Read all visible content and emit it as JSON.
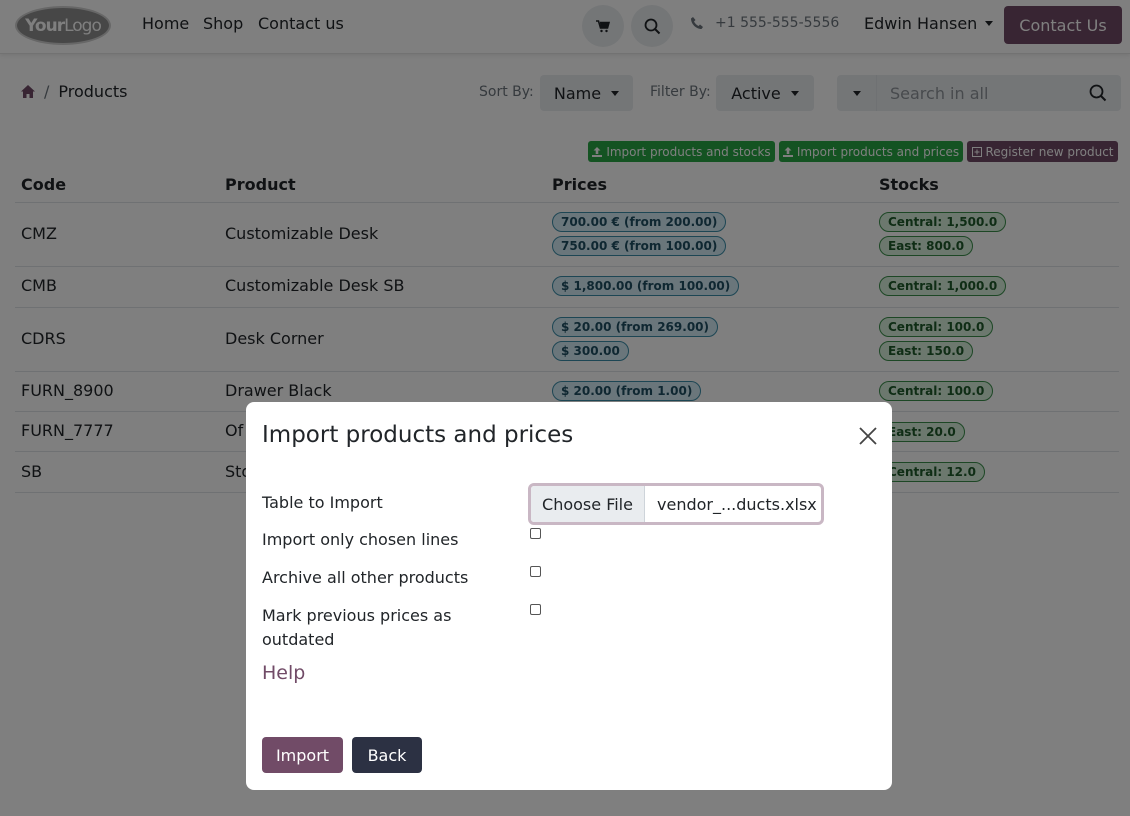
{
  "navbar": {
    "logo_text_bold": "Your",
    "logo_text_thin": "Logo",
    "links": [
      "Home",
      "Shop",
      "Contact us"
    ],
    "cart_icon": "shopping-cart-icon",
    "search_icon": "search-icon",
    "phone": "+1 555-555-5556",
    "user_name": "Edwin Hansen",
    "contact_button": "Contact Us"
  },
  "breadcrumb": {
    "home_icon": "home-icon",
    "separator": "/",
    "current": "Products"
  },
  "toolbar": {
    "sort_label": "Sort By:",
    "sort_value": "Name",
    "filter_label": "Filter By:",
    "filter_value": "Active",
    "search_placeholder": "Search in all"
  },
  "actions": {
    "import_stocks": "Import products and stocks",
    "import_prices": "Import products and prices",
    "register_new": "Register new product"
  },
  "table": {
    "headers": [
      "Code",
      "Product",
      "Prices",
      "Stocks"
    ],
    "rows": [
      {
        "code": "CMZ",
        "product": "Customizable Desk",
        "prices": [
          "700.00 € (from 200.00)",
          "750.00 € (from 100.00)"
        ],
        "stocks": [
          "Central: 1,500.0",
          "East: 800.0"
        ]
      },
      {
        "code": "CMB",
        "product": "Customizable Desk SB",
        "prices": [
          "$ 1,800.00 (from 100.00)"
        ],
        "stocks": [
          "Central: 1,000.0"
        ]
      },
      {
        "code": "CDRS",
        "product": "Desk Corner",
        "prices": [
          "$ 20.00 (from 269.00)",
          "$ 300.00"
        ],
        "stocks": [
          "Central: 100.0",
          "East: 150.0"
        ]
      },
      {
        "code": "FURN_8900",
        "product": "Drawer Black",
        "prices": [
          "$ 20.00 (from 1.00)"
        ],
        "stocks": [
          "Central: 100.0"
        ]
      },
      {
        "code": "FURN_7777",
        "product": "Of",
        "prices": [],
        "stocks": [
          "East: 20.0"
        ]
      },
      {
        "code": "SB",
        "product": "Sto",
        "prices": [],
        "stocks": [
          "Central: 12.0"
        ]
      }
    ]
  },
  "modal": {
    "title": "Import products and prices",
    "fields": {
      "table_to_import": "Table to Import",
      "import_chosen": "Import only chosen lines",
      "archive_others": "Archive all other products",
      "mark_outdated_1": "Mark previous prices as",
      "mark_outdated_2": "outdated"
    },
    "file_button": "Choose File",
    "file_name": "vendor_...ducts.xlsx",
    "help": "Help",
    "import_button": "Import",
    "back_button": "Back"
  },
  "colors": {
    "primary": "#714b67",
    "success": "#28a745",
    "dark": "#2c3143"
  }
}
